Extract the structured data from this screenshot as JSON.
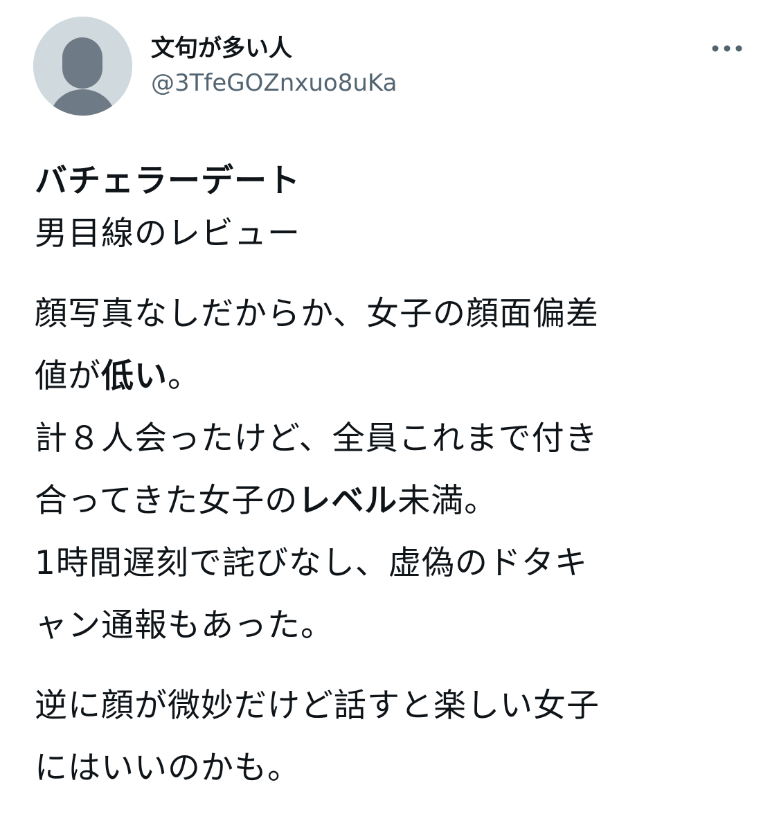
{
  "author": {
    "display_name": "文句が多い人",
    "handle": "@3TfeGOZnxuo8uKa",
    "avatar_icon": "default-avatar-icon"
  },
  "more_icon": "more-options-icon",
  "tweet": {
    "title": "バチェラーデート",
    "subtitle": "男目線のレビュー",
    "p1_l1": "顔写真なしだからか、女子の顔面偏差",
    "p1_l2_a": "値が",
    "p1_l2_b": "低い",
    "p1_l2_c": "。",
    "p1_l3": "計８人会ったけど、全員これまで付き",
    "p1_l4_a": "合ってきた女子の",
    "p1_l4_b": "レベル",
    "p1_l4_c": "未満。",
    "p1_l5": "1時間遅刻で詫びなし、虚偽のドタキ",
    "p1_l6": "ャン通報もあった。",
    "p2_l1": "逆に顔が微妙だけど話すと楽しい女子",
    "p2_l2": "にはいいのかも。"
  },
  "colors": {
    "text": "#0f1419",
    "secondary": "#536471",
    "avatar_bg": "#cfd9de",
    "avatar_fg": "#6e7a85"
  }
}
